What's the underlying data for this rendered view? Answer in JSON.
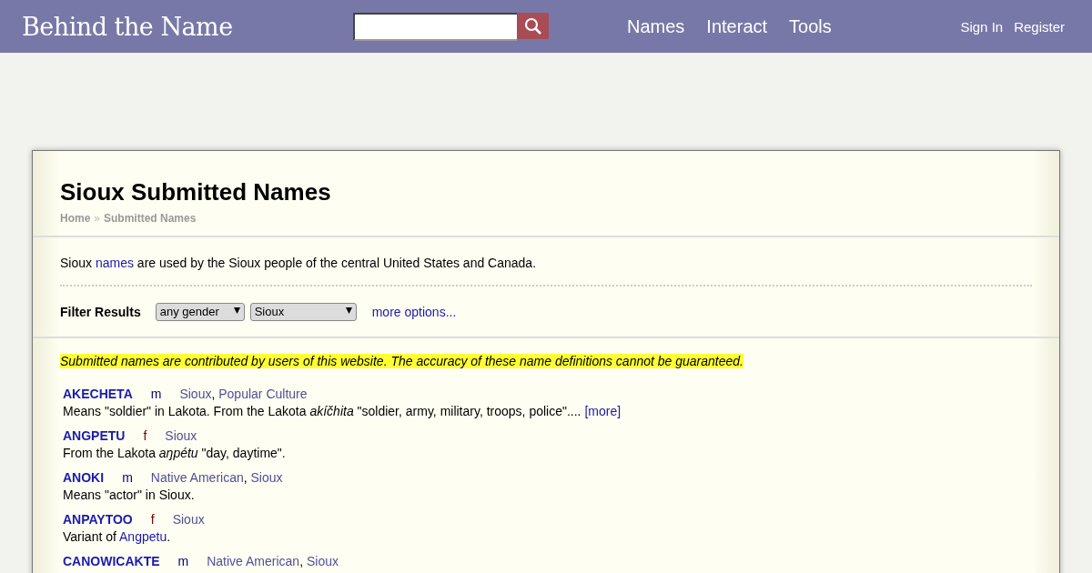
{
  "header": {
    "logo": "Behind the Name",
    "nav": [
      "Names",
      "Interact",
      "Tools"
    ],
    "account": [
      "Sign In",
      "Register"
    ]
  },
  "page": {
    "title": "Sioux Submitted Names",
    "breadcrumb": [
      "Home",
      "Submitted Names"
    ],
    "breadcrumb_separator": "»"
  },
  "intro": [
    {
      "kind": "text",
      "text": "Sioux "
    },
    {
      "kind": "link",
      "text": "names"
    },
    {
      "kind": "text",
      "text": " are used by the Sioux people of the central United States and Canada."
    }
  ],
  "filter": {
    "label": "Filter Results",
    "selects": [
      "any gender",
      "Sioux"
    ],
    "more": "more options..."
  },
  "usage_separator": ",",
  "notice": "Submitted names are contributed by users of this website. The accuracy of these name definitions cannot be guaranteed.",
  "names": [
    {
      "name": "AKECHETA",
      "gender": "m",
      "color": "#000080",
      "usages": [
        "Sioux",
        "Popular Culture"
      ],
      "definition": [
        {
          "kind": "text",
          "text": "Means \"soldier\" in Lakota. From the Lakota "
        },
        {
          "kind": "italic",
          "text": "akíčhita"
        },
        {
          "kind": "text",
          "text": " \"soldier, army, military, troops, police\".... "
        },
        {
          "kind": "link",
          "text": "[more]"
        }
      ]
    },
    {
      "name": "ANGPETU",
      "gender": "f",
      "color": "#800000",
      "usages": [
        "Sioux"
      ],
      "definition": [
        {
          "kind": "text",
          "text": "From the Lakota "
        },
        {
          "kind": "italic",
          "text": "aŋpétu"
        },
        {
          "kind": "text",
          "text": " \"day, daytime\"."
        }
      ]
    },
    {
      "name": "ANOKI",
      "gender": "m",
      "color": "#000080",
      "usages": [
        "Native American",
        "Sioux"
      ],
      "definition": [
        {
          "kind": "text",
          "text": "Means \"actor\" in Sioux."
        }
      ]
    },
    {
      "name": "ANPAYTOO",
      "gender": "f",
      "color": "#800000",
      "usages": [
        "Sioux"
      ],
      "definition": [
        {
          "kind": "text",
          "text": "Variant of "
        },
        {
          "kind": "link",
          "text": "Angpetu"
        },
        {
          "kind": "text",
          "text": "."
        }
      ]
    },
    {
      "name": "CANOWICAKTE",
      "gender": "m",
      "color": "#000080",
      "usages": [
        "Native American",
        "Sioux"
      ]
    }
  ]
}
